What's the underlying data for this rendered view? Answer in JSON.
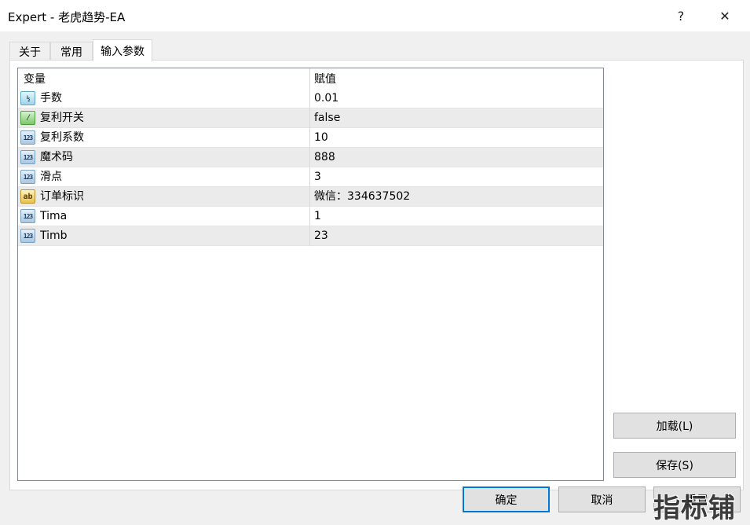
{
  "window": {
    "title": "Expert - 老虎趋势-EA",
    "help_label": "?",
    "close_label": "✕"
  },
  "tabs": [
    {
      "label": "关于"
    },
    {
      "label": "常用"
    },
    {
      "label": "输入参数",
      "active": true
    }
  ],
  "grid": {
    "columns": [
      "变量",
      "赋值"
    ],
    "rows": [
      {
        "type": "frac",
        "icon": "fraction-icon",
        "icon_text": "½",
        "name": "手数",
        "value": "0.01"
      },
      {
        "type": "bool",
        "icon": "boolean-icon",
        "icon_text": "⁄",
        "name": "复利开关",
        "value": "false"
      },
      {
        "type": "num",
        "icon": "integer-icon",
        "icon_text": "123",
        "name": "复利系数",
        "value": "10"
      },
      {
        "type": "num",
        "icon": "integer-icon",
        "icon_text": "123",
        "name": "魔术码",
        "value": "888"
      },
      {
        "type": "num",
        "icon": "integer-icon",
        "icon_text": "123",
        "name": "滑点",
        "value": "3"
      },
      {
        "type": "str",
        "icon": "string-icon",
        "icon_text": "ab",
        "name": "订单标识",
        "value": "微信：334637502"
      },
      {
        "type": "num",
        "icon": "integer-icon",
        "icon_text": "123",
        "name": "Tima",
        "value": "1"
      },
      {
        "type": "num",
        "icon": "integer-icon",
        "icon_text": "123",
        "name": "Timb",
        "value": "23"
      }
    ]
  },
  "buttons": {
    "load": "加载(L)",
    "save": "保存(S)",
    "ok": "确定",
    "cancel": "取消",
    "reset": "重置"
  },
  "watermark": "指标铺",
  "colors": {
    "accent": "#0078d7",
    "row_alt": "#ebebeb",
    "dialog_bg": "#f0f0f0"
  }
}
